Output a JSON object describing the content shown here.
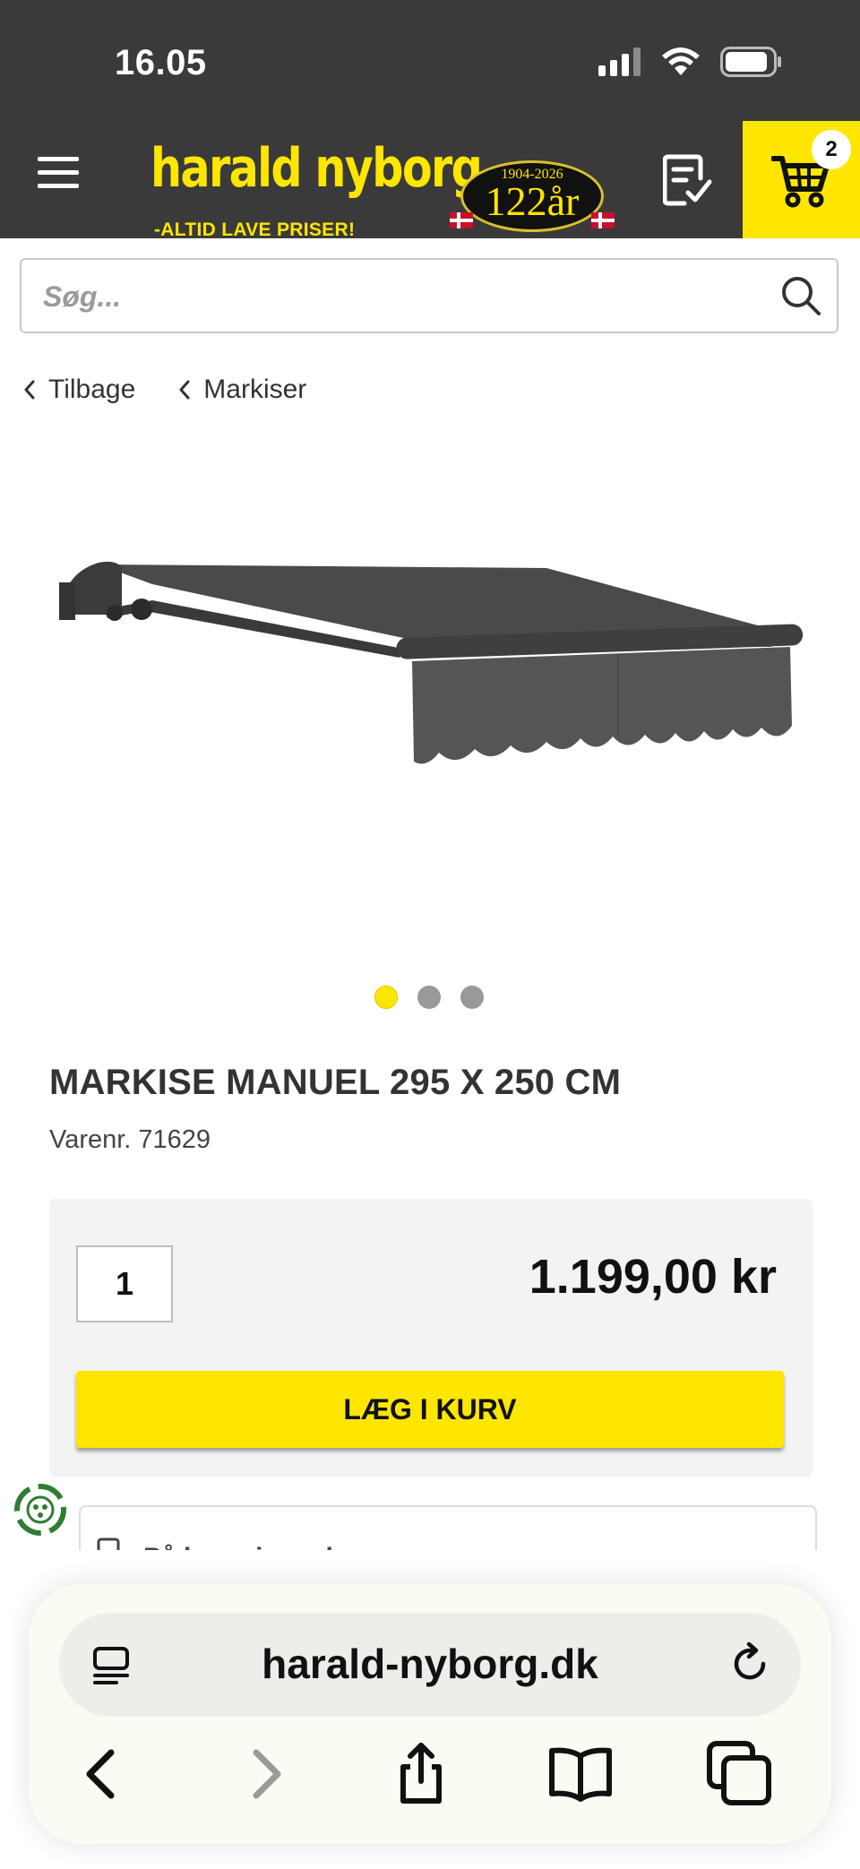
{
  "status_bar": {
    "time": "16.05"
  },
  "header": {
    "logo_text": "harald nyborg",
    "logo_tagline": "-ALTID LAVE PRISER!",
    "anniversary_years": "1904-2026",
    "anniversary_number": "122år",
    "cart_count": "2",
    "brand_color": "#ffe600",
    "icons": [
      "menu-icon",
      "shopping-list-icon",
      "cart-icon"
    ]
  },
  "search": {
    "placeholder": "Søg..."
  },
  "breadcrumbs": [
    {
      "label": "Tilbage"
    },
    {
      "label": "Markiser"
    }
  ],
  "carousel": {
    "total": 3,
    "active": 1
  },
  "product": {
    "title": "MARKISE MANUEL 295 X 250 CM",
    "sku_label": "Varenr. 71629",
    "quantity": "1",
    "price": "1.199,00 kr",
    "add_to_cart_label": "LÆG I KURV"
  },
  "partial_section": {
    "label": "På lager i varehus"
  },
  "browser": {
    "url": "harald-nyborg.dk",
    "icons": [
      "reader-icon",
      "reload-icon",
      "back-icon",
      "forward-icon",
      "share-icon",
      "bookmarks-icon",
      "tabs-icon"
    ]
  }
}
